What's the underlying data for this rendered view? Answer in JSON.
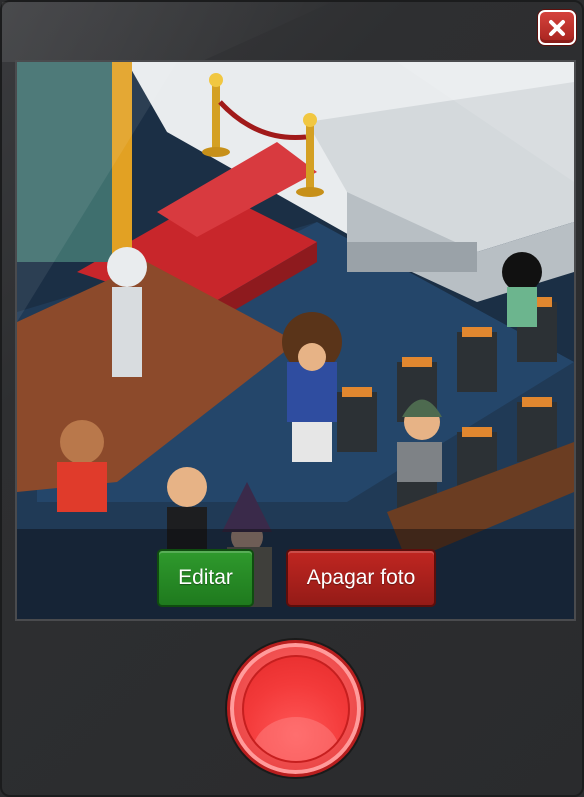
{
  "window": {
    "close_icon": "close-x-icon"
  },
  "photo": {
    "description_icon": "habbo-room-photo"
  },
  "actions": {
    "edit_label": "Editar",
    "delete_label": "Apagar foto"
  },
  "shutter": {
    "icon": "camera-shutter-button"
  },
  "colors": {
    "edit_button": "#2f9a2d",
    "delete_button": "#c02621",
    "shutter": "#f25252",
    "close_button": "#d5423c",
    "frame_bg": "#2b2c2e"
  }
}
